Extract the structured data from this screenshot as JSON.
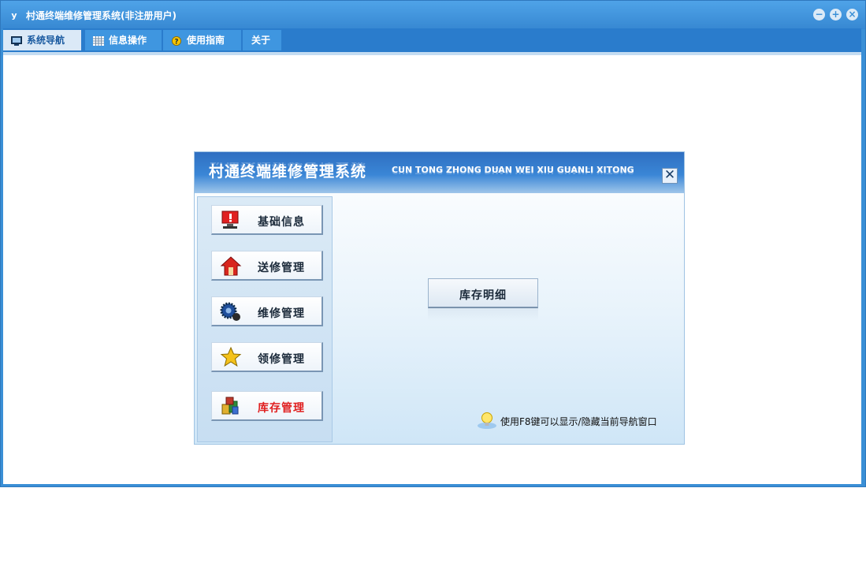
{
  "window": {
    "title": "村通终端维修管理系统(非注册用户)",
    "icon_glyph": "y",
    "controls": {
      "minimize": "−",
      "maximize": "+",
      "close": "×"
    }
  },
  "menu": {
    "tabs": [
      {
        "label": "系统导航",
        "icon": "monitor-icon"
      },
      {
        "label": "信息操作",
        "icon": "grid-icon"
      },
      {
        "label": "使用指南",
        "icon": "help-icon"
      },
      {
        "label": "关于"
      }
    ]
  },
  "nav_panel": {
    "title_cn": "村通终端维修管理系统",
    "title_en": "CUN TONG ZHONG DUAN WEI XIU GUANLI XITONG",
    "close_glyph": "✕",
    "buttons": [
      {
        "label": "基础信息",
        "icon": "alert-monitor-icon"
      },
      {
        "label": "送修管理",
        "icon": "house-icon"
      },
      {
        "label": "维修管理",
        "icon": "gear-icon"
      },
      {
        "label": "领修管理",
        "icon": "star-icon"
      },
      {
        "label": "库存管理",
        "icon": "boxes-icon",
        "active": true
      }
    ],
    "detail_button": "库存明细",
    "tip": "使用F8键可以显示/隐藏当前导航窗口"
  },
  "colors": {
    "window_blue": "#3a8fd6",
    "active_label": "#e02020"
  }
}
